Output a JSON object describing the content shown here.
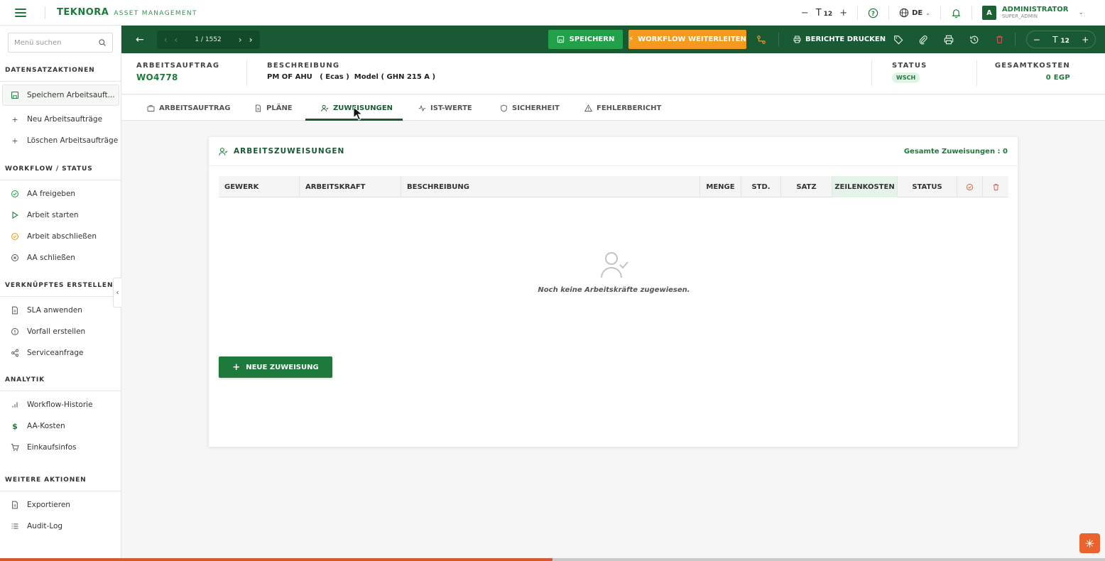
{
  "app": {
    "brand_name": "TEKNORA",
    "brand_sub": "ASSET MANAGEMENT",
    "font_size": "12",
    "language": "DE",
    "user_initial": "A",
    "user_name": "ADMINISTRATOR",
    "user_role": "SUPER_ADMIN"
  },
  "sidebar": {
    "search_placeholder": "Menü suchen",
    "sections": [
      {
        "heading": "DATENSATZAKTIONEN",
        "items": [
          {
            "label": "Speichern Arbeitsauft...",
            "icon": "save-icon"
          },
          {
            "label": "Neu Arbeitsaufträge",
            "icon": "plus-icon"
          },
          {
            "label": "Löschen Arbeitsaufträge",
            "icon": "plus-icon"
          }
        ]
      },
      {
        "heading": "WORKFLOW / STATUS",
        "items": [
          {
            "label": "AA freigeben",
            "icon": "check-circle-icon"
          },
          {
            "label": "Arbeit starten",
            "icon": "play-icon"
          },
          {
            "label": "Arbeit abschließen",
            "icon": "clock-check-icon"
          },
          {
            "label": "AA schließen",
            "icon": "x-circle-icon"
          }
        ]
      },
      {
        "heading": "VERKNÜPFTES ERSTELLEN",
        "items": [
          {
            "label": "SLA anwenden",
            "icon": "document-icon"
          },
          {
            "label": "Vorfall erstellen",
            "icon": "alert-circle-icon"
          },
          {
            "label": "Serviceanfrage",
            "icon": "share-icon"
          }
        ]
      },
      {
        "heading": "ANALYTIK",
        "items": [
          {
            "label": "Workflow-Historie",
            "icon": "bar-chart-icon"
          },
          {
            "label": "AA-Kosten",
            "icon": "dollar-icon"
          },
          {
            "label": "Einkaufsinfos",
            "icon": "cart-icon"
          }
        ]
      },
      {
        "heading": "WEITERE AKTIONEN",
        "items": [
          {
            "label": "Exportieren",
            "icon": "document-icon"
          },
          {
            "label": "Audit-Log",
            "icon": "list-icon"
          }
        ]
      }
    ]
  },
  "toolbar": {
    "pager_text": "1 / 1552",
    "save_label": "SPEICHERN",
    "workflow_label": "WORKFLOW WEITERLEITEN",
    "print_reports_label": "BERICHTE DRUCKEN",
    "zoom_value": "12"
  },
  "record": {
    "wo_label": "ARBEITSAUFTRAG",
    "wo_value": "WO4778",
    "desc_label": "BESCHREIBUNG",
    "desc_value": "PM OF AHU   ( Ecas )  Model ( GHN 215 A )",
    "status_label": "STATUS",
    "status_value": "WSCH",
    "cost_label": "GESAMTKOSTEN",
    "cost_value": "0 EGP"
  },
  "tabs": [
    {
      "label": "ARBEITSAUFTRAG",
      "icon": "briefcase-icon"
    },
    {
      "label": "PLÄNE",
      "icon": "document-icon"
    },
    {
      "label": "ZUWEISUNGEN",
      "icon": "user-check-icon"
    },
    {
      "label": "IST-WERTE",
      "icon": "activity-icon"
    },
    {
      "label": "SICHERHEIT",
      "icon": "shield-icon"
    },
    {
      "label": "FEHLERBERICHT",
      "icon": "warning-icon"
    }
  ],
  "assignments": {
    "title": "ARBEITSZUWEISUNGEN",
    "total_text": "Gesamte Zuweisungen : 0",
    "columns": [
      "GEWERK",
      "ARBEITSKRAFT",
      "BESCHREIBUNG",
      "MENGE",
      "STD.",
      "SATZ",
      "ZEILENKOSTEN",
      "STATUS"
    ],
    "empty_message": "Noch keine Arbeitskräfte zugewiesen.",
    "new_button": "NEUE ZUWEISUNG"
  },
  "progress": 0.5
}
